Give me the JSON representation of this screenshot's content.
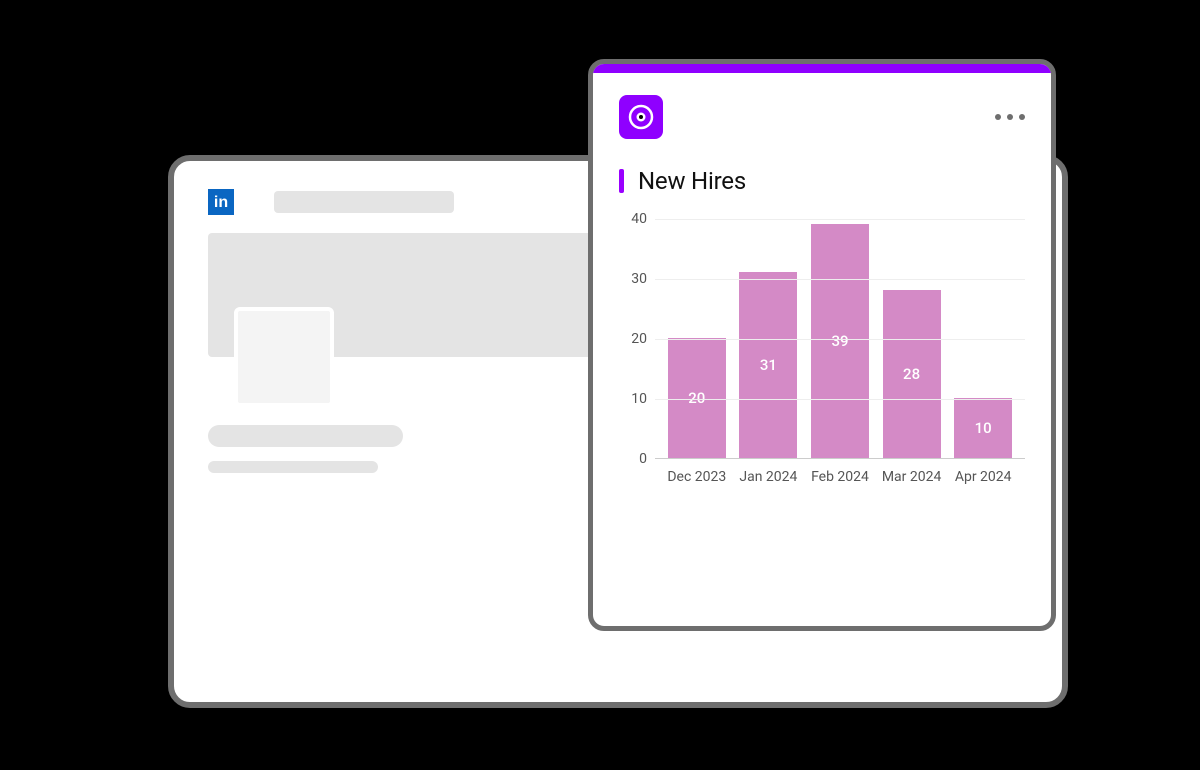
{
  "back_card": {
    "brand_icon": "linkedin-icon",
    "brand_letters": "in"
  },
  "widget": {
    "logo_icon": "target-icon",
    "more_label": "more-options",
    "title": "New Hires",
    "accent_color": "#8f00ff",
    "bar_color": "#d48ac6"
  },
  "chart_data": {
    "type": "bar",
    "title": "New Hires",
    "xlabel": "",
    "ylabel": "",
    "ylim": [
      0,
      40
    ],
    "y_ticks": [
      0,
      10,
      20,
      30,
      40
    ],
    "categories": [
      "Dec 2023",
      "Jan 2024",
      "Feb 2024",
      "Mar 2024",
      "Apr 2024"
    ],
    "values": [
      20,
      31,
      39,
      28,
      10
    ]
  }
}
